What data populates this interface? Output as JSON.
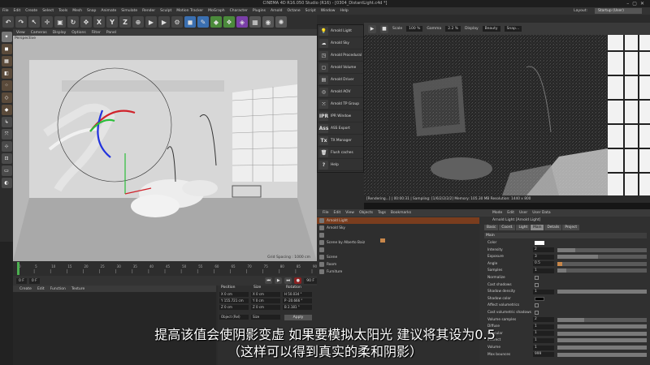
{
  "window": {
    "title": "CINEMA 4D R16.050 Studio (R16) - [0304_DistantLight.c4d *]"
  },
  "menubar": {
    "items": [
      "File",
      "Edit",
      "Create",
      "Select",
      "Tools",
      "Mesh",
      "Snap",
      "Animate",
      "Simulate",
      "Render",
      "Sculpt",
      "Motion Tracker",
      "MoGraph",
      "Character",
      "Plugins",
      "Arnold",
      "Octane",
      "Script",
      "Window",
      "Help"
    ],
    "layout_label": "Layout:",
    "layout_value": "Startup (User)"
  },
  "viewport": {
    "menu": [
      "View",
      "Cameras",
      "Display",
      "Options",
      "Filter",
      "Panel"
    ],
    "label": "Perspective",
    "grid_spacing": "Grid Spacing : 1000 cm"
  },
  "timeline": {
    "start": "0 F",
    "end": "90 F",
    "current": "0 F",
    "ticks": [
      "0",
      "5",
      "10",
      "15",
      "20",
      "25",
      "30",
      "35",
      "40",
      "45",
      "50",
      "55",
      "60",
      "65",
      "70",
      "75",
      "80",
      "85",
      "90"
    ]
  },
  "material_manager": {
    "menu": [
      "Create",
      "Edit",
      "Function",
      "Texture"
    ]
  },
  "coordinates": {
    "headers": [
      "Position",
      "Size",
      "Rotation"
    ],
    "rows": [
      {
        "a": "X  0 cm",
        "b": "X  0 cm",
        "c": "H  50.034 °"
      },
      {
        "a": "Y  155.721 cm",
        "b": "Y  0 cm",
        "c": "P  -20.666 °"
      },
      {
        "a": "Z  0 cm",
        "b": "Z  0 cm",
        "c": "B  2.181 °"
      }
    ],
    "mode": "Object (Rel)",
    "size_mode": "Size",
    "apply": "Apply"
  },
  "arnold_menu": {
    "items": [
      {
        "icon": "bulb-icon",
        "label": "Arnold Light"
      },
      {
        "icon": "sky-icon",
        "label": "Arnold Sky"
      },
      {
        "icon": "procedural-icon",
        "label": "Arnold Procedural"
      },
      {
        "icon": "volume-icon",
        "label": "Arnold Volume"
      },
      {
        "icon": "driver-icon",
        "label": "Arnold Driver"
      },
      {
        "icon": "aov-icon",
        "label": "Arnold AOV"
      },
      {
        "icon": "tp-group-icon",
        "label": "Arnold TP Group"
      },
      {
        "icon": "ipr-icon",
        "glyph": "IPR",
        "label": "IPR Window"
      },
      {
        "icon": "ass-icon",
        "glyph": "Ass",
        "label": "ASS Export"
      },
      {
        "icon": "tx-icon",
        "glyph": "Tx",
        "label": "TX Manager"
      },
      {
        "icon": "trash-icon",
        "label": "Flush caches"
      },
      {
        "icon": "help-icon",
        "glyph": "?",
        "label": "Help"
      }
    ]
  },
  "ipr": {
    "scale_label": "Scale",
    "scale_value": "100 %",
    "gamma_label": "Gamma",
    "gamma_value": "2.2 %",
    "display_label": "Display",
    "display_value": "Beauty",
    "extra": "Snap...",
    "status": "[Rendering...]  |  00:00:31  |  Sampling: [1/6/2/2/2/2]  Memory: 105.30 MB  Resolution: 1440 x 800"
  },
  "object_manager": {
    "menu": [
      "File",
      "Edit",
      "View",
      "Objects",
      "Tags",
      "Bookmarks"
    ],
    "objects": [
      "Arnold Light",
      "Arnold Sky",
      "",
      "Scene by Alberto Baiz",
      "",
      "Scene",
      "Room",
      "Furniture"
    ]
  },
  "attributes": {
    "menu": [
      "Mode",
      "Edit",
      "User",
      "User Data"
    ],
    "title": "Arnold Light [Arnold Light]",
    "tabs": [
      "Basic",
      "Coord.",
      "Light",
      "Main",
      "Details",
      "Project"
    ],
    "active_tab": "Main",
    "section": "Main",
    "rows": [
      {
        "label": "Color",
        "value": "",
        "kind": "color"
      },
      {
        "label": "Intensity",
        "value": "2",
        "level": 0.2
      },
      {
        "label": "Exposure",
        "value": "3",
        "level": 0.45
      },
      {
        "label": "Angle",
        "value": "0.5",
        "level": 0.05
      },
      {
        "label": "Samples",
        "value": "1",
        "level": 0.1
      },
      {
        "label": "Normalize",
        "value": "",
        "kind": "check"
      },
      {
        "label": "Cast shadows",
        "value": "",
        "kind": "check"
      },
      {
        "label": "Shadow density",
        "value": "1",
        "level": 1
      },
      {
        "label": "Shadow color",
        "value": "",
        "kind": "swatch"
      },
      {
        "label": "Affect volumetrics",
        "value": "",
        "kind": "check"
      },
      {
        "label": "Cast volumetric shadows",
        "value": "",
        "kind": "check"
      },
      {
        "label": "Volume samples",
        "value": "2",
        "level": 0.3
      },
      {
        "label": "Diffuse",
        "value": "1",
        "level": 1
      },
      {
        "label": "Specular",
        "value": "1",
        "level": 1
      },
      {
        "label": "Indirect",
        "value": "1",
        "level": 1
      },
      {
        "label": "Volume",
        "value": "1",
        "level": 1
      },
      {
        "label": "Max bounces",
        "value": "999",
        "level": 1
      }
    ]
  },
  "subtitles": {
    "line1": "提高该值会使阴影变虚 如果要模拟太阳光 建议将其设为0.5",
    "line2": "（这样可以得到真实的柔和阴影）"
  },
  "colors": {
    "accent": "#c8874a",
    "viewport": "#b9b9b9",
    "gizmo_red": "#d0222a",
    "gizmo_green": "#2bbf3a",
    "gizmo_blue": "#2233dd"
  }
}
